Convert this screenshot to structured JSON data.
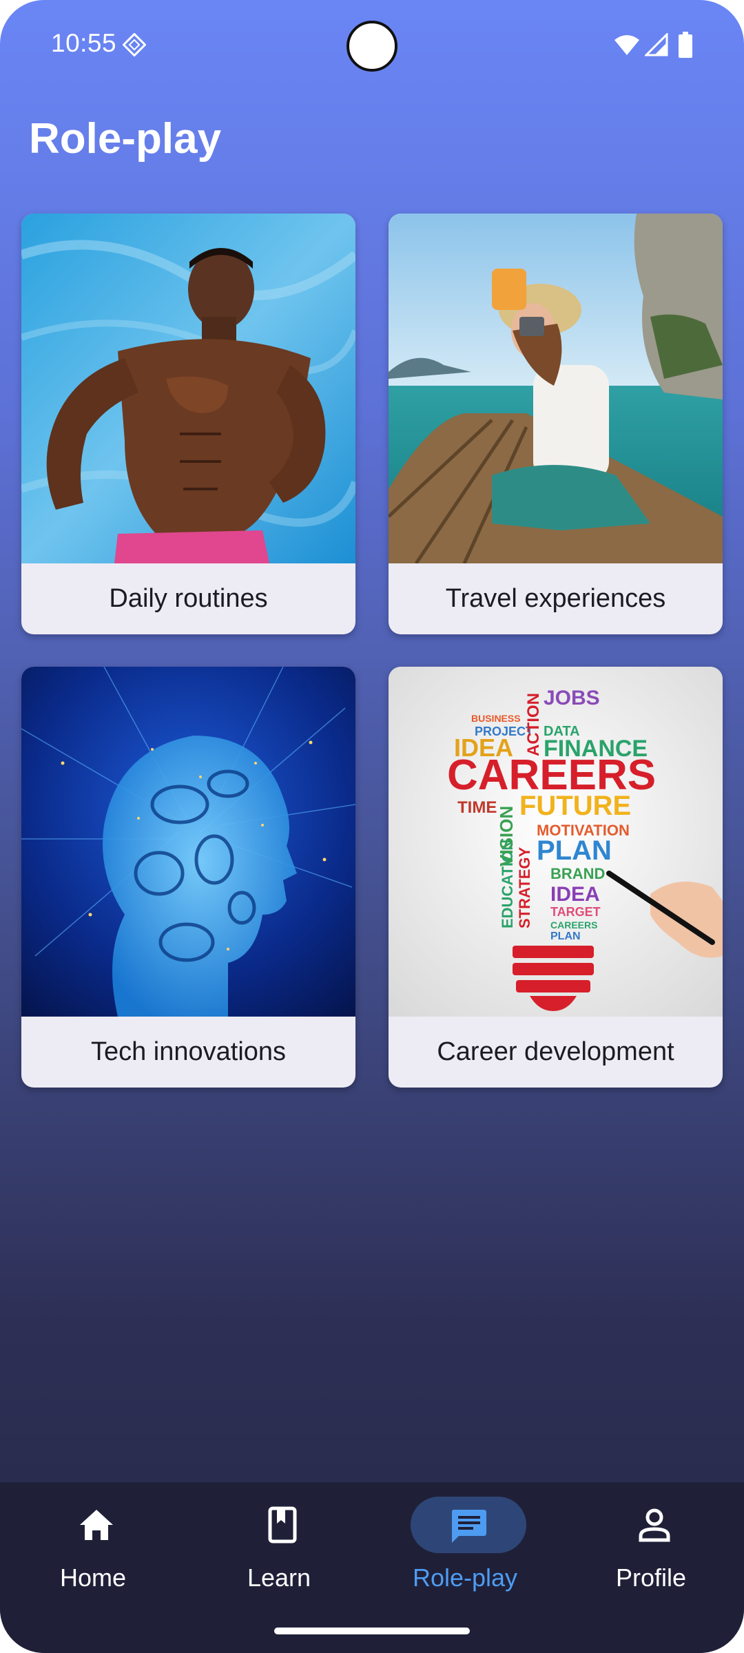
{
  "status_bar": {
    "time": "10:55",
    "icons": [
      "location-diamond-icon",
      "wifi-icon",
      "cellular-signal-icon",
      "battery-icon"
    ]
  },
  "header": {
    "title": "Role-play"
  },
  "cards": [
    {
      "label": "Daily routines",
      "image": "runner-photo"
    },
    {
      "label": "Travel experiences",
      "image": "boat-traveler-photo"
    },
    {
      "label": "Tech innovations",
      "image": "digital-head-photo"
    },
    {
      "label": "Career development",
      "image": "careers-lightbulb-photo"
    }
  ],
  "bottom_nav": {
    "items": [
      {
        "label": "Home",
        "icon": "home-icon"
      },
      {
        "label": "Learn",
        "icon": "book-icon"
      },
      {
        "label": "Role-play",
        "icon": "chat-icon",
        "active": true
      },
      {
        "label": "Profile",
        "icon": "person-icon"
      }
    ]
  },
  "theme": {
    "accent": "#4e9cf2",
    "active_pill": "#2e4677",
    "nav_background": "#1f2038",
    "gradient_top": "#6a86f5",
    "gradient_bottom": "#262848"
  }
}
